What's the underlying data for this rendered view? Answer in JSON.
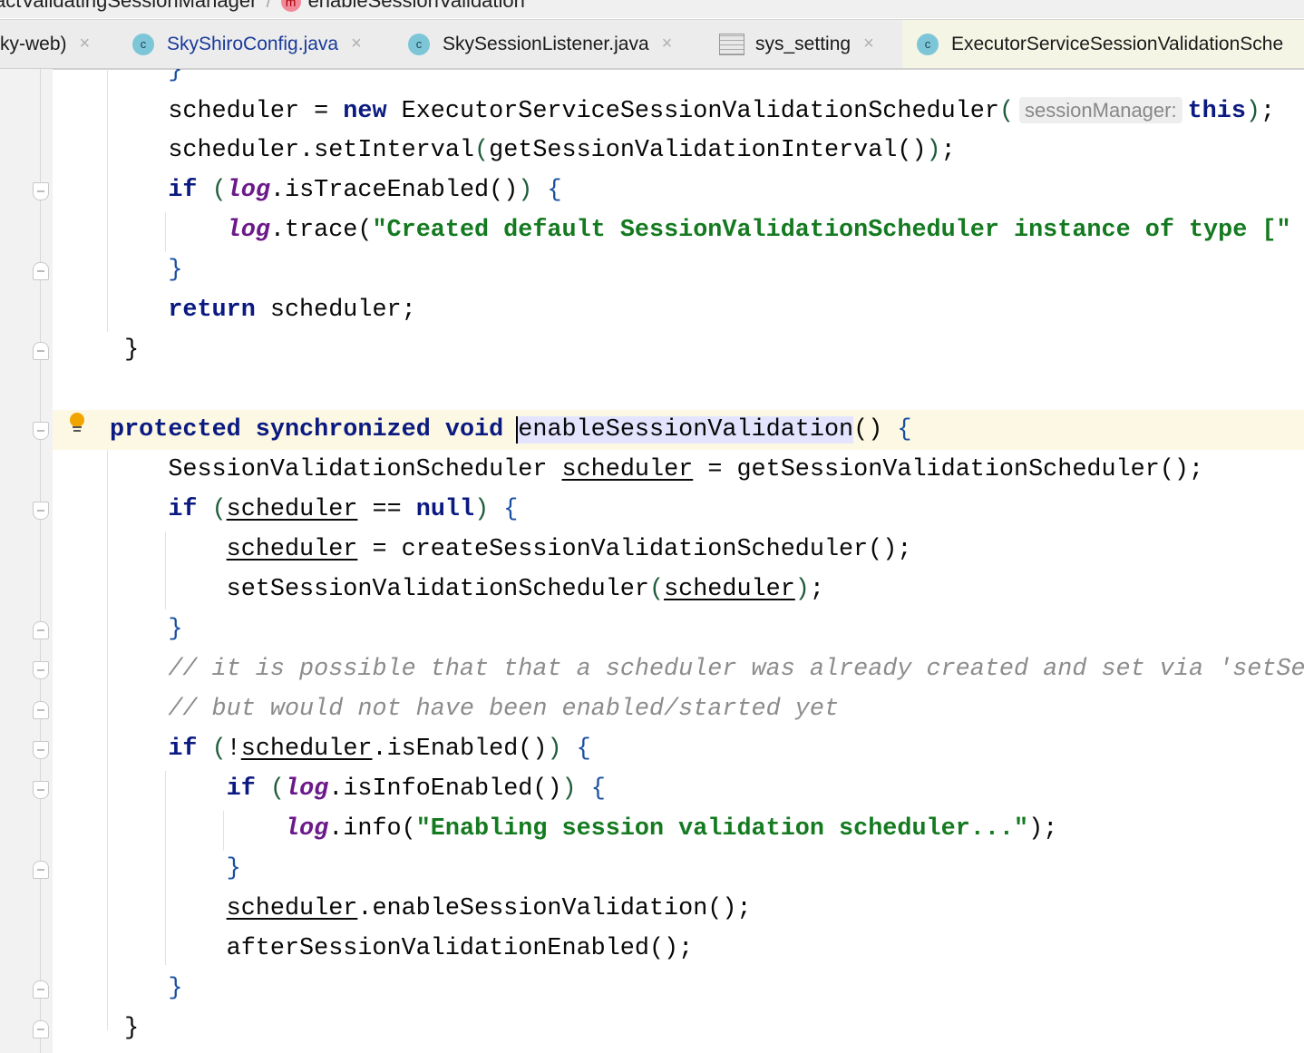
{
  "breadcrumb": {
    "class_name": "actValidatingSessionManager",
    "method_icon": "m",
    "method_name": "enableSessionValidation"
  },
  "tabs": [
    {
      "label": "ky-web)",
      "icon": "none"
    },
    {
      "label": "SkyShiroConfig.java",
      "icon": "class-icon"
    },
    {
      "label": "SkySessionListener.java",
      "icon": "class-icon"
    },
    {
      "label": "sys_setting",
      "icon": "table-icon"
    },
    {
      "label": "ExecutorServiceSessionValidationSche",
      "icon": "class-icon",
      "active": true
    }
  ],
  "tab_close": "×",
  "class_icon_letter": "c",
  "code": [
    {
      "indent": 4,
      "t": [
        [
          "}",
          "p2"
        ]
      ]
    },
    {
      "indent": 4,
      "fold": "",
      "t": [
        [
          "scheduler = ",
          ""
        ],
        [
          "new",
          "kw"
        ],
        [
          " ExecutorServiceSessionValidationScheduler",
          ""
        ],
        [
          "(",
          "p1"
        ],
        [
          "sessionManager:",
          "hint"
        ],
        [
          "this",
          "kw"
        ],
        [
          ")",
          "p1"
        ],
        [
          ";",
          ""
        ]
      ]
    },
    {
      "indent": 4,
      "t": [
        [
          "scheduler.setInterval",
          ""
        ],
        [
          "(",
          "p1"
        ],
        [
          "getSessionValidationInterval()",
          ""
        ],
        [
          ")",
          "p1"
        ],
        [
          ";",
          ""
        ]
      ]
    },
    {
      "indent": 4,
      "fold": "start",
      "t": [
        [
          "if",
          "kw"
        ],
        [
          " ",
          ""
        ],
        [
          "(",
          "p1"
        ],
        [
          "log",
          "fld"
        ],
        [
          ".isTraceEnabled()",
          ""
        ],
        [
          ")",
          "p1"
        ],
        [
          " ",
          ""
        ],
        [
          "{",
          "p2"
        ]
      ]
    },
    {
      "indent": 8,
      "t": [
        [
          "log",
          "fld"
        ],
        [
          ".trace(",
          ""
        ],
        [
          "\"Created default SessionValidationScheduler instance of type [\" +",
          "str"
        ]
      ]
    },
    {
      "indent": 4,
      "fold": "end",
      "t": [
        [
          "}",
          "p2"
        ]
      ]
    },
    {
      "indent": 4,
      "t": [
        [
          "return",
          "kw"
        ],
        [
          " scheduler;",
          ""
        ]
      ]
    },
    {
      "indent": 0,
      "fold": "end",
      "t": [
        [
          " }",
          ""
        ]
      ]
    },
    {
      "indent": 0,
      "t": []
    },
    {
      "indent": 0,
      "fold": "start",
      "current": true,
      "t": [
        [
          "protected synchronized void",
          "kw"
        ],
        [
          " ",
          ""
        ],
        [
          "enableSessionValidation",
          "hl"
        ],
        [
          "() ",
          ""
        ],
        [
          "{",
          "p2"
        ]
      ]
    },
    {
      "indent": 4,
      "t": [
        [
          "SessionValidationScheduler ",
          ""
        ],
        [
          "scheduler",
          "ul"
        ],
        [
          " = getSessionValidationScheduler();",
          ""
        ]
      ]
    },
    {
      "indent": 4,
      "fold": "start",
      "t": [
        [
          "if",
          "kw"
        ],
        [
          " ",
          ""
        ],
        [
          "(",
          "p1"
        ],
        [
          "scheduler",
          "ul"
        ],
        [
          " == ",
          ""
        ],
        [
          "null",
          "kw"
        ],
        [
          ")",
          "p1"
        ],
        [
          " ",
          ""
        ],
        [
          "{",
          "p2"
        ]
      ]
    },
    {
      "indent": 8,
      "t": [
        [
          "scheduler",
          "ul"
        ],
        [
          " = createSessionValidationScheduler();",
          ""
        ]
      ]
    },
    {
      "indent": 8,
      "t": [
        [
          "setSessionValidationScheduler",
          ""
        ],
        [
          "(",
          "p1"
        ],
        [
          "scheduler",
          "ul"
        ],
        [
          ")",
          "p1"
        ],
        [
          ";",
          ""
        ]
      ]
    },
    {
      "indent": 4,
      "fold": "end",
      "t": [
        [
          "}",
          "p2"
        ]
      ]
    },
    {
      "indent": 4,
      "fold": "start",
      "t": [
        [
          "// it is possible that that a scheduler was already created and set via 'setSes",
          "cm"
        ]
      ]
    },
    {
      "indent": 4,
      "fold": "end",
      "t": [
        [
          "// but would not have been enabled/started yet",
          "cm"
        ]
      ]
    },
    {
      "indent": 4,
      "fold": "start",
      "t": [
        [
          "if",
          "kw"
        ],
        [
          " ",
          ""
        ],
        [
          "(",
          "p1"
        ],
        [
          "!",
          ""
        ],
        [
          "scheduler",
          "ul"
        ],
        [
          ".isEnabled()",
          ""
        ],
        [
          ")",
          "p1"
        ],
        [
          " ",
          ""
        ],
        [
          "{",
          "p2"
        ]
      ]
    },
    {
      "indent": 8,
      "fold": "start",
      "t": [
        [
          "if",
          "kw"
        ],
        [
          " ",
          ""
        ],
        [
          "(",
          "p1"
        ],
        [
          "log",
          "fld"
        ],
        [
          ".isInfoEnabled()",
          ""
        ],
        [
          ")",
          "p1"
        ],
        [
          " ",
          ""
        ],
        [
          "{",
          "p2"
        ]
      ]
    },
    {
      "indent": 12,
      "t": [
        [
          "log",
          "fld"
        ],
        [
          ".info(",
          ""
        ],
        [
          "\"Enabling session validation scheduler...\"",
          "str"
        ],
        [
          ");",
          ""
        ]
      ]
    },
    {
      "indent": 8,
      "fold": "end",
      "t": [
        [
          "}",
          "p2"
        ]
      ]
    },
    {
      "indent": 8,
      "t": [
        [
          "scheduler",
          "ul"
        ],
        [
          ".enableSessionValidation();",
          ""
        ]
      ]
    },
    {
      "indent": 8,
      "t": [
        [
          "afterSessionValidationEnabled();",
          ""
        ]
      ]
    },
    {
      "indent": 4,
      "fold": "end",
      "t": [
        [
          "}",
          "p2"
        ]
      ]
    },
    {
      "indent": 0,
      "fold": "end",
      "t": [
        [
          " }",
          ""
        ]
      ]
    }
  ]
}
